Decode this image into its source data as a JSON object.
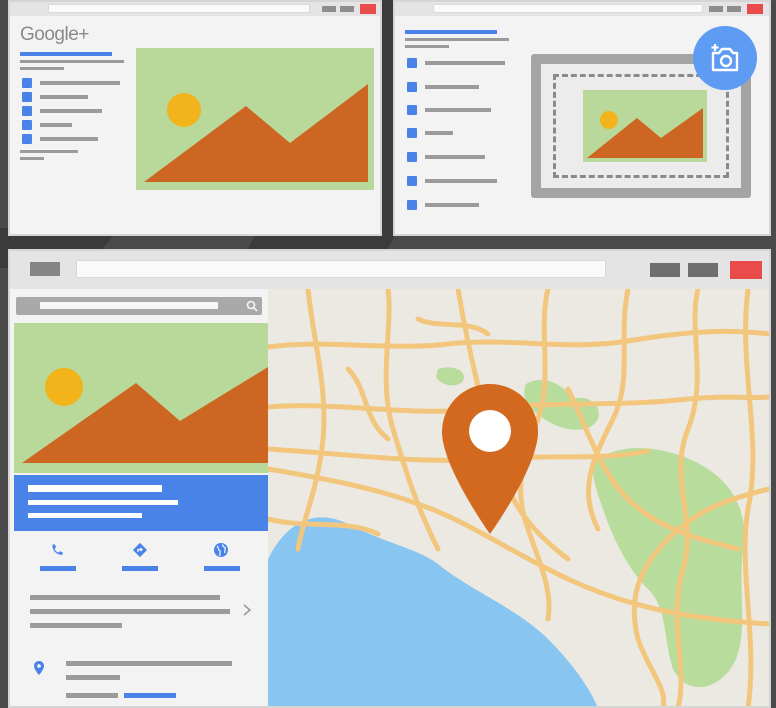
{
  "brand": "Google+",
  "colors": {
    "accent_blue": "#4a83e8",
    "close_red": "#e94a4a",
    "image_green": "#b8d99a",
    "mountain_orange": "#cc6622",
    "sun_yellow": "#f2b31b",
    "map_land": "#ece9e2",
    "map_road": "#f2c77d",
    "map_water": "#88c6f1",
    "map_park": "#b7dc9c",
    "pin_orange": "#d2691e"
  },
  "icons": {
    "camera": "add-photo-icon",
    "phone": "phone-icon",
    "directions": "directions-icon",
    "website": "globe-icon",
    "search": "search-icon",
    "chevron": "chevron-right-icon",
    "location": "location-pin-icon",
    "map_marker": "map-marker-icon"
  }
}
